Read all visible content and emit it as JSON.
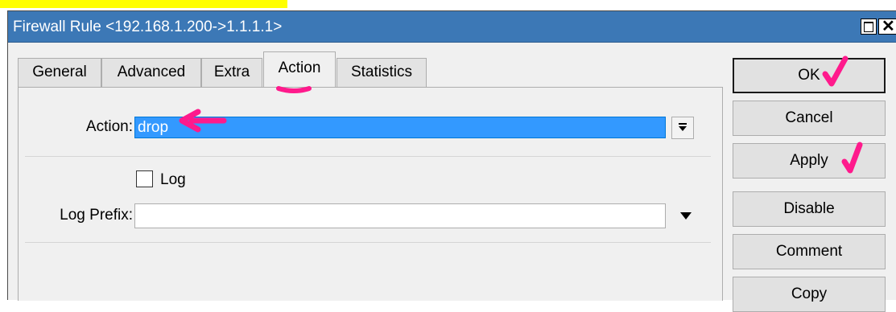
{
  "window": {
    "title": "Firewall Rule <192.168.1.200->1.1.1.1>",
    "close_glyph": "✕"
  },
  "tabs": [
    {
      "label": "General"
    },
    {
      "label": "Advanced"
    },
    {
      "label": "Extra"
    },
    {
      "label": "Action",
      "active": true
    },
    {
      "label": "Statistics"
    }
  ],
  "form": {
    "action_label": "Action:",
    "action_value": "drop",
    "log_label": "Log",
    "log_checked": false,
    "log_prefix_label": "Log Prefix:",
    "log_prefix_value": ""
  },
  "buttons": {
    "ok": "OK",
    "cancel": "Cancel",
    "apply": "Apply",
    "disable": "Disable",
    "comment": "Comment",
    "copy": "Copy"
  },
  "colors": {
    "titlebar": "#3c78b6",
    "selection": "#3399ff",
    "annotation": "#ff1a8c",
    "highlight": "#ffff00"
  },
  "icons": {
    "maximize": "maximize-icon",
    "close": "close-icon",
    "dropdown": "dropdown-arrow-icon"
  }
}
